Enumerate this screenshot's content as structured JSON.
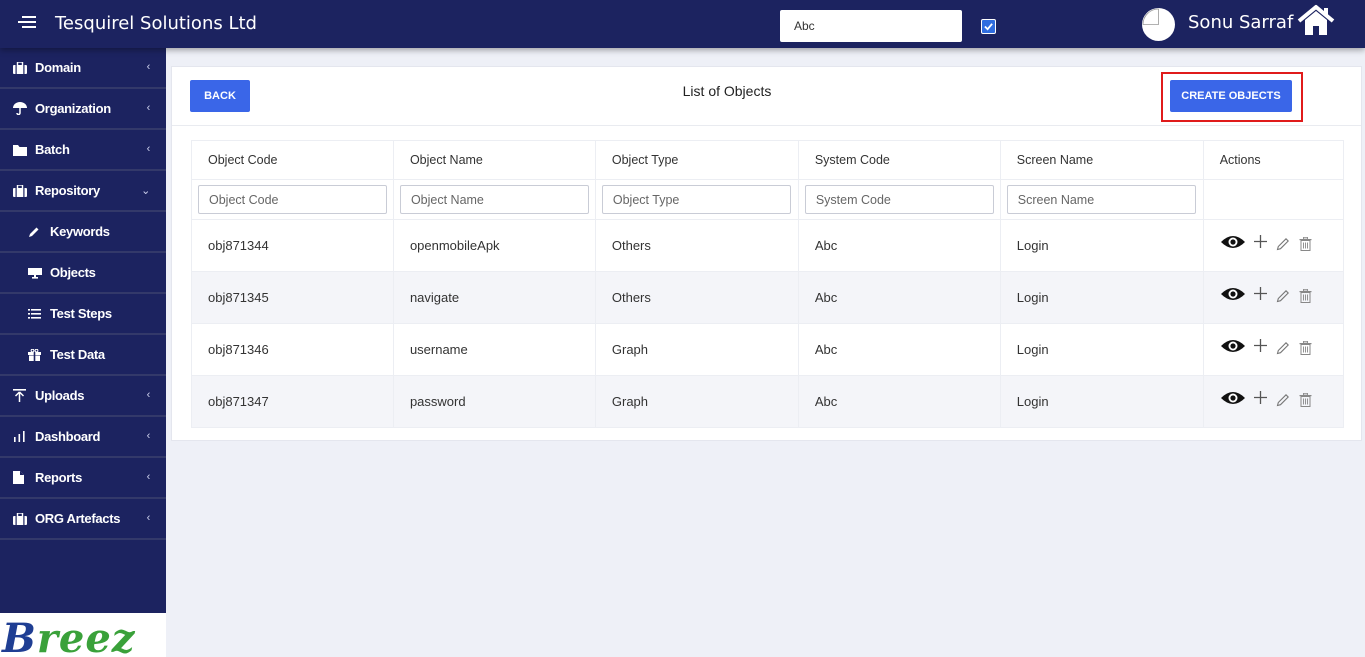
{
  "topbar": {
    "app_title": "Tesquirel Solutions Ltd",
    "select_value": "Abc",
    "checkbox_checked": true,
    "user_name": "Sonu Sarraf"
  },
  "sidebar": {
    "items": [
      {
        "label": "Domain",
        "icon": "briefcase-icon",
        "chevron": "‹"
      },
      {
        "label": "Organization",
        "icon": "umbrella-icon",
        "chevron": "‹"
      },
      {
        "label": "Batch",
        "icon": "folder-icon",
        "chevron": "‹"
      },
      {
        "label": "Repository",
        "icon": "briefcase-icon",
        "chevron": "⌄"
      },
      {
        "label": "Keywords",
        "icon": "pencil-icon"
      },
      {
        "label": "Objects",
        "icon": "monitor-icon"
      },
      {
        "label": "Test Steps",
        "icon": "list-icon"
      },
      {
        "label": "Test Data",
        "icon": "gift-icon"
      },
      {
        "label": "Uploads",
        "icon": "upload-icon",
        "chevron": "‹"
      },
      {
        "label": "Dashboard",
        "icon": "bar-chart-icon",
        "chevron": "‹"
      },
      {
        "label": "Reports",
        "icon": "file-icon",
        "chevron": "‹"
      },
      {
        "label": "ORG Artefacts",
        "icon": "briefcase-icon",
        "chevron": "‹"
      }
    ],
    "logo": {
      "b": "B",
      "rest": "reez"
    }
  },
  "main": {
    "back_label": "BACK",
    "title": "List of Objects",
    "create_label": "CREATE OBJECTS",
    "table": {
      "headers": [
        "Object Code",
        "Object Name",
        "Object Type",
        "System Code",
        "Screen Name",
        "Actions"
      ],
      "filters": [
        "Object Code",
        "Object Name",
        "Object Type",
        "System Code",
        "Screen Name"
      ],
      "rows": [
        [
          "obj871344",
          "openmobileApk",
          "Others",
          "Abc",
          "Login"
        ],
        [
          "obj871345",
          "navigate",
          "Others",
          "Abc",
          "Login"
        ],
        [
          "obj871346",
          "username",
          "Graph",
          "Abc",
          "Login"
        ],
        [
          "obj871347",
          "password",
          "Graph",
          "Abc",
          "Login"
        ]
      ]
    }
  },
  "colors": {
    "navy": "#1c2360",
    "button_blue": "#3a66e8",
    "highlight_red": "#e01b1b",
    "logo_blue": "#1f3e93",
    "logo_green": "#3aa13a"
  }
}
